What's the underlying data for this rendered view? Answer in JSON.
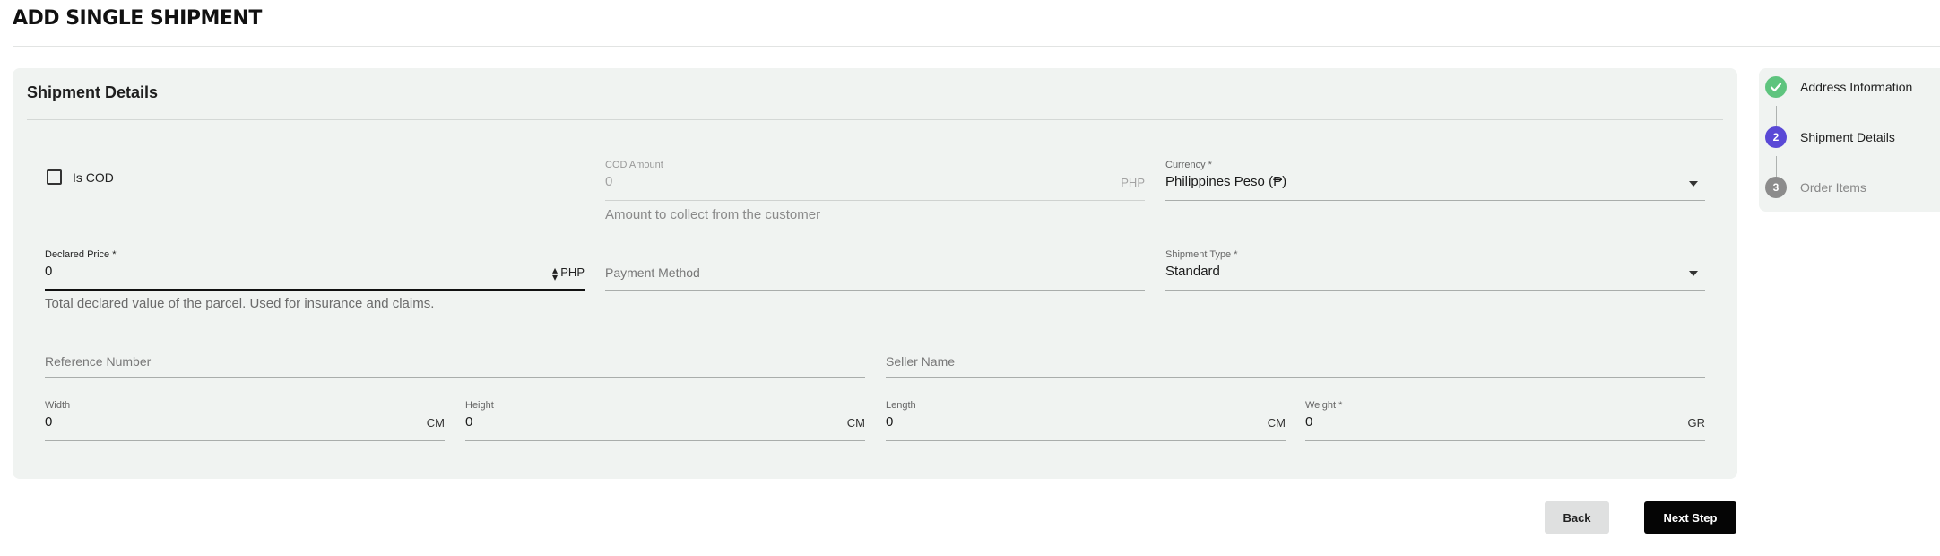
{
  "page_title": "ADD SINGLE SHIPMENT",
  "card": {
    "title": "Shipment Details"
  },
  "is_cod": {
    "label": "Is COD",
    "checked": false
  },
  "cod_amount": {
    "label": "COD Amount",
    "value": "0",
    "unit": "PHP",
    "helper": "Amount to collect from the customer"
  },
  "currency": {
    "label": "Currency *",
    "value": "Philippines Peso (₱)"
  },
  "declared_price": {
    "label": "Declared Price *",
    "value": "0",
    "unit": "PHP",
    "helper": "Total declared value of the parcel. Used for insurance and claims."
  },
  "payment_method": {
    "placeholder": "Payment Method"
  },
  "shipment_type": {
    "label": "Shipment Type *",
    "value": "Standard"
  },
  "reference_number": {
    "placeholder": "Reference Number"
  },
  "seller_name": {
    "placeholder": "Seller Name"
  },
  "dimensions": {
    "width": {
      "label": "Width",
      "value": "0",
      "unit": "CM"
    },
    "height": {
      "label": "Height",
      "value": "0",
      "unit": "CM"
    },
    "length": {
      "label": "Length",
      "value": "0",
      "unit": "CM"
    },
    "weight": {
      "label": "Weight *",
      "value": "0",
      "unit": "GR"
    }
  },
  "buttons": {
    "back": "Back",
    "next": "Next Step"
  },
  "steps": [
    {
      "number": "✓",
      "label": "Address Information",
      "status": "completed",
      "color": "#5ec47e",
      "icon": "check-icon"
    },
    {
      "number": "2",
      "label": "Shipment Details",
      "status": "active",
      "color": "#5a49d6",
      "icon": "step-number-icon"
    },
    {
      "number": "3",
      "label": "Order Items",
      "status": "pending",
      "color": "#8c8c8c",
      "icon": "step-number-icon"
    }
  ]
}
